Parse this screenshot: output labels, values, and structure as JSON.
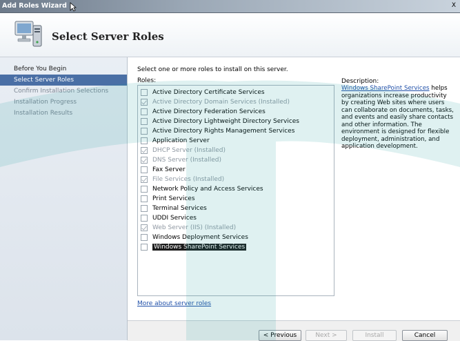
{
  "window": {
    "title": "Add Roles Wizard",
    "close_label": "X"
  },
  "header": {
    "title": "Select Server Roles",
    "icon": "server-computer-icon"
  },
  "nav": [
    {
      "label": "Before You Begin",
      "state": "normal"
    },
    {
      "label": "Select Server Roles",
      "state": "active"
    },
    {
      "label": "Confirm Installation Selections",
      "state": "disabled"
    },
    {
      "label": "Installation Progress",
      "state": "disabled"
    },
    {
      "label": "Installation Results",
      "state": "disabled"
    }
  ],
  "content": {
    "instructions": "Select one or more roles to install on this server.",
    "roles_label": "Roles:",
    "roles": [
      {
        "name": "Active Directory Certificate Services",
        "checked": false,
        "installed": false
      },
      {
        "name": "Active Directory Domain Services  (Installed)",
        "checked": true,
        "installed": true
      },
      {
        "name": "Active Directory Federation Services",
        "checked": false,
        "installed": false
      },
      {
        "name": "Active Directory Lightweight Directory Services",
        "checked": false,
        "installed": false
      },
      {
        "name": "Active Directory Rights Management Services",
        "checked": false,
        "installed": false
      },
      {
        "name": "Application Server",
        "checked": false,
        "installed": false
      },
      {
        "name": "DHCP Server  (Installed)",
        "checked": true,
        "installed": true
      },
      {
        "name": "DNS Server  (Installed)",
        "checked": true,
        "installed": true
      },
      {
        "name": "Fax Server",
        "checked": false,
        "installed": false
      },
      {
        "name": "File Services  (Installed)",
        "checked": true,
        "installed": true
      },
      {
        "name": "Network Policy and Access Services",
        "checked": false,
        "installed": false
      },
      {
        "name": "Print Services",
        "checked": false,
        "installed": false
      },
      {
        "name": "Terminal Services",
        "checked": false,
        "installed": false
      },
      {
        "name": "UDDI Services",
        "checked": false,
        "installed": false
      },
      {
        "name": "Web Server (IIS)  (Installed)",
        "checked": true,
        "installed": true
      },
      {
        "name": "Windows Deployment Services",
        "checked": false,
        "installed": false
      },
      {
        "name": "Windows SharePoint Services",
        "checked": false,
        "installed": false,
        "selected": true
      }
    ],
    "description_title": "Description:",
    "description_link": "Windows SharePoint Services",
    "description_text": " helps organizations increase productivity by creating Web sites where users can collaborate on documents, tasks, and events and easily share contacts and other information. The environment is designed for flexible deployment, administration, and application development.",
    "more_link": "More about server roles"
  },
  "footer": {
    "previous_label": "< Previous",
    "next_label": "Next >",
    "install_label": "Install",
    "cancel_label": "Cancel"
  }
}
